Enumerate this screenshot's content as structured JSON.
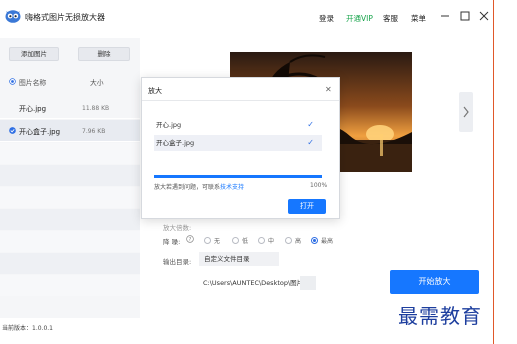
{
  "app": {
    "title": "嗨格式图片无损放大器"
  },
  "topnav": {
    "login": "登录",
    "vip": "开通VIP",
    "service": "客服",
    "menu": "菜单"
  },
  "sidebar": {
    "add_button": "添加图片",
    "delete_button": "删除",
    "col_name": "图片名称",
    "col_size": "大小",
    "files": [
      {
        "name": "开心.jpg",
        "size": "11.88 KB",
        "checked": false
      },
      {
        "name": "开心盒子.jpg",
        "size": "7.96 KB",
        "checked": true
      }
    ]
  },
  "settings": {
    "scale_label": "放大倍数:",
    "denoise_label": "降 噪:",
    "denoise_options": [
      "无",
      "低",
      "中",
      "高",
      "最高"
    ],
    "denoise_selected": "最高",
    "output_label": "输出目录:",
    "output_dir_button": "自定义文件目录",
    "output_path": "C:\\Users\\AUNTEC\\Desktop\\图片\\"
  },
  "start_button": "开始放大",
  "status": {
    "version": "当前版本：1.0.0.1"
  },
  "watermark": "最需教育",
  "modal": {
    "title": "放大",
    "files": [
      "开心.jpg",
      "开心盒子.jpg"
    ],
    "progress_percent": 100,
    "progress_text": "100%",
    "note": "放大若遇到问题，可联系",
    "note_link": "技术支持",
    "open_button": "打开"
  },
  "colors": {
    "accent": "#1677ff",
    "vip": "#16a34a",
    "border_accent": "#e0582a"
  }
}
